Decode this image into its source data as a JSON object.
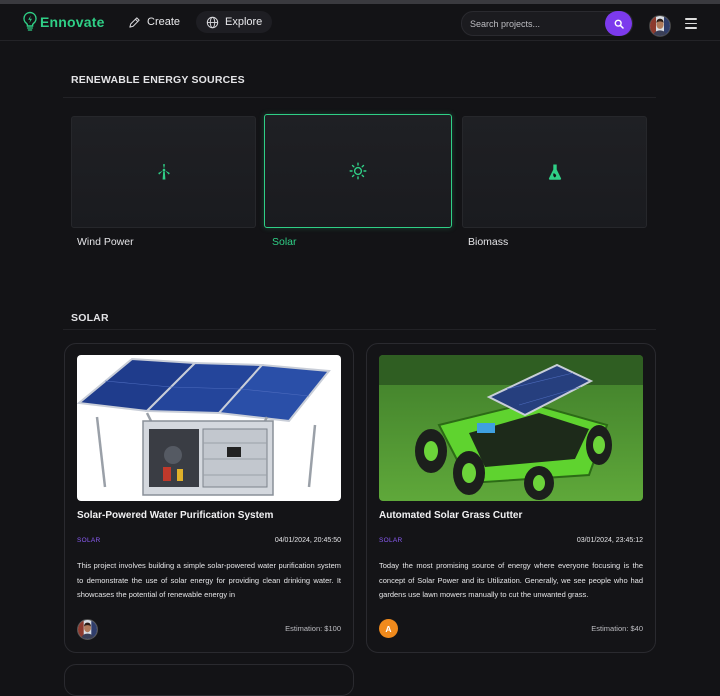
{
  "brand": {
    "name": "Ennovate",
    "color": "#2fcf86",
    "icon": "bulb-bolt-icon"
  },
  "nav": {
    "create_label": "Create",
    "explore_label": "Explore"
  },
  "search": {
    "placeholder": "Search projects...",
    "accent": "#7c3aed"
  },
  "categories_section": {
    "title": "RENEWABLE ENERGY SOURCES",
    "items": [
      {
        "label": "Wind Power",
        "icon": "wind-turbine-icon",
        "active": false
      },
      {
        "label": "Solar",
        "icon": "sun-icon",
        "active": true
      },
      {
        "label": "Biomass",
        "icon": "flask-leaf-icon",
        "active": false
      }
    ]
  },
  "projects_section": {
    "title": "SOLAR",
    "projects": [
      {
        "title": "Solar-Powered Water Purification System",
        "tag": "SOLAR",
        "date": "04/01/2024, 20:45:50",
        "description": "This project involves building a simple solar-powered water purification system to demonstrate the use of solar energy for providing clean drinking water. It showcases the potential of renewable energy in",
        "estimation": "Estimation: $100",
        "author_avatar": "photo"
      },
      {
        "title": "Automated Solar Grass Cutter",
        "tag": "SOLAR",
        "date": "03/01/2024, 23:45:12",
        "description": "Today the most promising source of energy where everyone focusing is the concept of Solar Power and its Utilization. Generally, we see people who had gardens use lawn mowers manually to cut the unwanted grass.",
        "estimation": "Estimation: $40",
        "author_avatar": "A"
      }
    ]
  }
}
